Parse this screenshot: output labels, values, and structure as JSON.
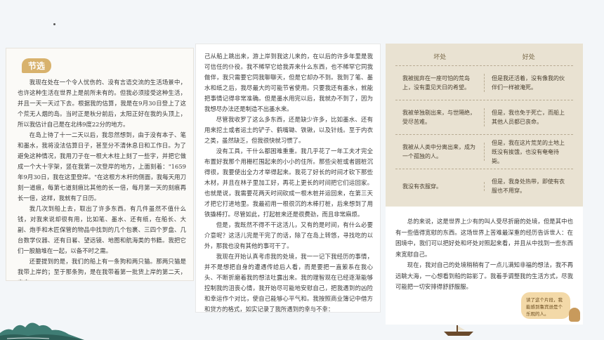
{
  "page1": {
    "heading": "节选",
    "paragraphs": [
      "我现在处在一个令人忧伤的、没有言语交流的生活场景中，也许这种生活在世界上是前所未有的。但我必须接受这种生活，并且一天一天过下去。根据我的估算，我是在9月30日登上了这个荒无人烟的岛。当时正是秋分前后，太阳正好在我的头顶上，所以我估计自己是在北纬9度22分的地方。",
      "在岛上待了十一二天以后，我忽然想到，由于没有本子、笔和墨水，我将没法估算日子，甚至分不清休息日和工作日。为了避免这种情况，我用刀子在一根大木柱上刻了一些字，并把它做成一个大十字架，竖在我第一次登岸的地方，上面刻着：\"1659年9月30日，我在这里登岸。\"在这根方木杆的侧面，我每天用刀刻一道痕，每第七道刻痕比其他的长一倍，每月第一天的刻痕再长一倍，这样，我就有了日历。",
      "我几次到船上去，取出了许多东西。有几件虽然不值什么钱，对我来说却很有用，比如笔、墨水、还有纸，在船长、大副、炮手和木匠保管的物品中找到的几个包裹、三四个罗盘、几台数学仪器、还有日晷、望远镜、地图和航海类的书籍。我把它们一股脑堆在一起，以备不时之需。",
      "还要提到的是，我们的船上有一条狗和两只猫。那两只猫是我带上岸的；至于那条狗，是在我带着第一批货上岸的第二天，它自"
    ]
  },
  "page2": {
    "paragraphs": [
      "己从船上跳出来，游上岸到我这儿来的，在以后的许多年里是我可信任的仆役。我不稀罕它给我弄来什么东西，也不稀罕它同我做伴，我只需要它同我聊聊天，但是它却办不到。我到了笔、墨水和纸之后，我尽最大的可能节省使用。只要我还有墨水，就能把事情记得非常准确。但是墨水用完以后，我就办不到了，因为我想尽办法还是制造不出墨水来。",
      "尽管我收罗了这么多东西，还是缺少许多，比如墨水、还有用来挖土或者运土的铲子、鹤嘴锄、铁锹，以及针线。至于内衣之类，虽然缺乏，但我很快就习惯了。",
      "没有工具，干什么都困难重重。我几乎花了一年工夫才完全布置好我那个用栅栏围起来的小小的住所。那些尖桩或者圆桩沉得很，我要使出全力才举得起来。我花了好长的时间才砍下那些木材，并且在林子里加工好，再花上更长的时间把它们运回家。也就是说，我需要花两天时间砍成一根木桩并运回来，在第三天才把它打进地里。我最初用一根很沉的木棒打桩，后来想到了用铁撬棒打。尽管如此，打起桩来还是很费劲，而且非常麻烦。",
      "但是，我既然不得不干这活儿，又有的是时间，有什么必要介意呢？这活儿完是干完了的话，除了在岛上转悠，寻找吃的以外，那我也没有其他的事可干了。",
      "我现在开始认真考虑我的处境，我一一记下我经历的事情，并不是想把自身的遭遇传给后人看，而是要把一直萦系在我心头、不断折磨着我的想法吐露出来。我的理智现在已经逐渐能够控制我的沮丧心情，我开始尽可能地安慰自己，把我遇到的凶险和幸运作个对比，使自己能够心平气和。我按照商业簿记中借方和贷方的格式，如实记录了我所遇到的幸与不幸："
    ]
  },
  "page3": {
    "table": {
      "col_bad": "坏处",
      "col_good": "好处",
      "rows": [
        {
          "bad": "我被抛弃在一座可怕的荒岛上，没有重见天日的希望。",
          "good": "但是我还活着，没有像我的伙伴们一样被淹死。"
        },
        {
          "bad": "我被单独剔出来，与世隔绝，受尽苦难。",
          "good": "但是，我也免于死亡，而船上其他人员都已丧命。"
        },
        {
          "bad": "我被从人类中分离出来，成为一个孤独的人。",
          "good": "但是，我在这片荒芜的土地上既没有挨饿，也没有奄奄待毙。"
        },
        {
          "bad": "我没有衣服穿。",
          "good": "但是，我身处热带，即使有衣服也不用穿。"
        }
      ]
    },
    "paragraphs": [
      "总的来说，这是世界上少有的叫人受尽折磨的处境，但是其中也有一些值得宽慰的东西。这场世界上苦难最深重的经历告诉世人：在困境中，我们可以把好处和坏处对照起来看，并且从中找到一些东西来宽慰自己。",
      "现在，我对自己的处境稍稍有了一点儿满知非福的想法，我不再远眺大海，一心想看到船的踪影了。我着手调整我的生活方式，尽我可能把一切安排得舒舒服服。"
    ],
    "bubble": "读了这个片段，我能感到鲁宾逊是个乐观的人。"
  }
}
